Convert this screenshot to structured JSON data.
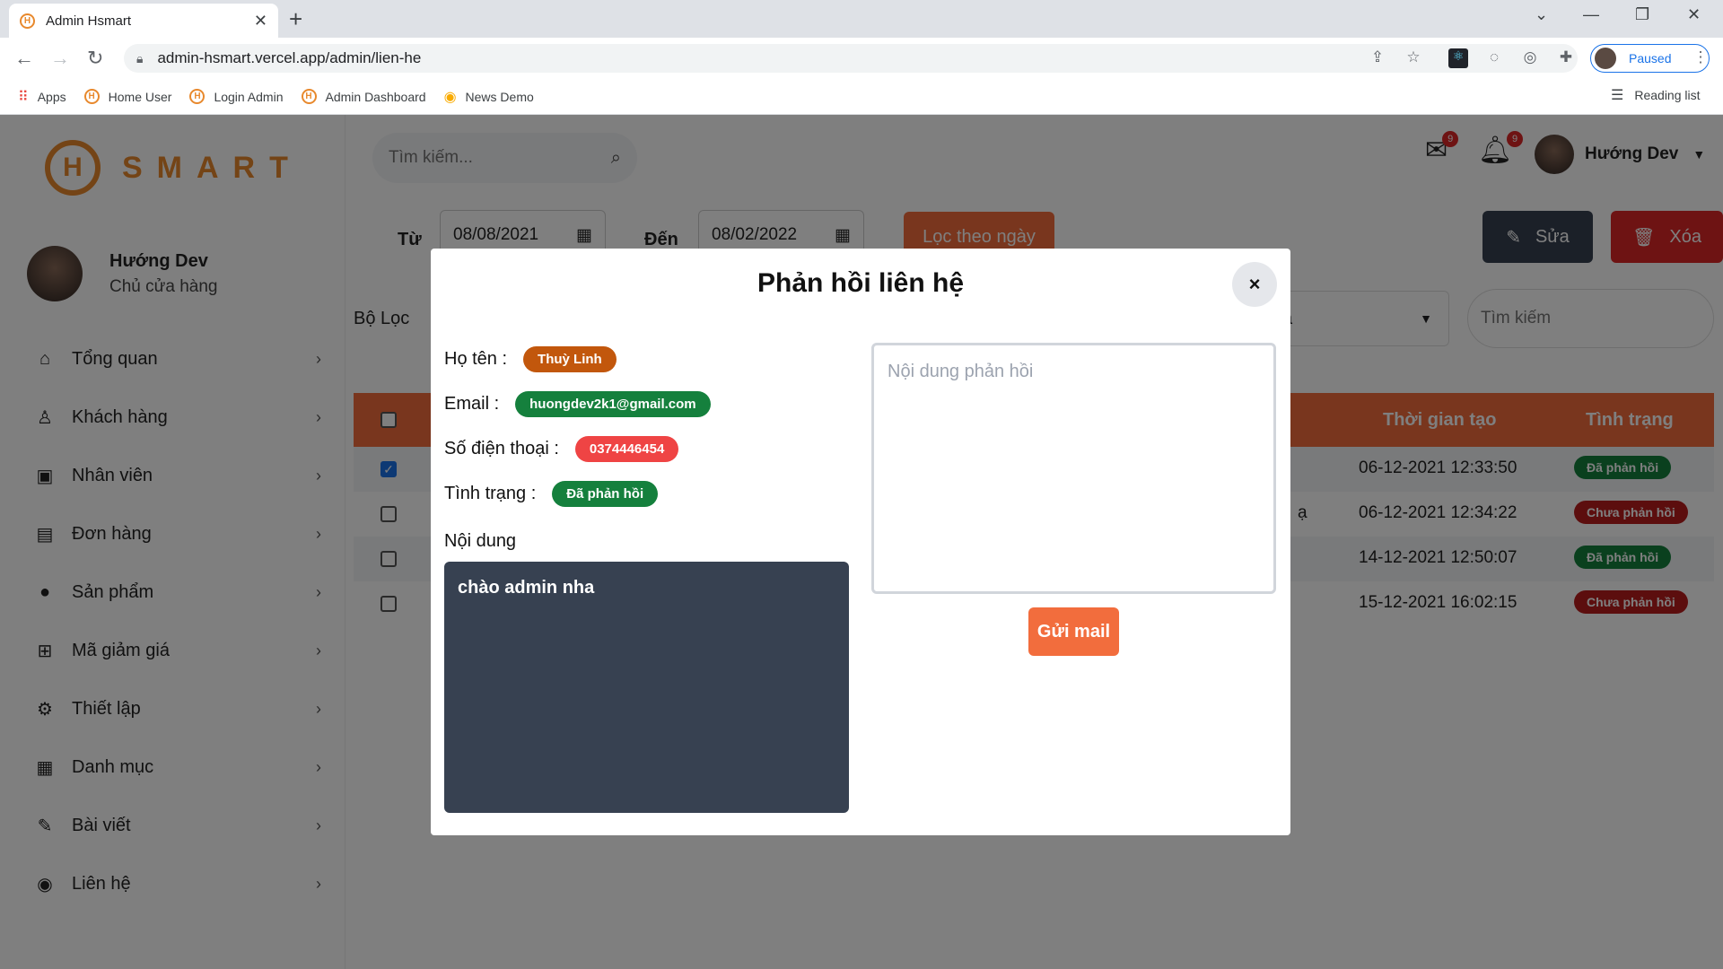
{
  "browser": {
    "tab_title": "Admin Hsmart",
    "url": "admin-hsmart.vercel.app/admin/lien-he",
    "profile_label": "Paused",
    "bookmarks": [
      "Apps",
      "Home User",
      "Login Admin",
      "Admin Dashboard",
      "News Demo"
    ],
    "reading_list": "Reading list"
  },
  "logo": {
    "letter": "H",
    "word": "SMART"
  },
  "sidebar": {
    "user_name": "Hướng Dev",
    "user_role": "Chủ cửa hàng",
    "items": [
      {
        "label": "Tổng quan",
        "icon": "home-icon"
      },
      {
        "label": "Khách hàng",
        "icon": "user-icon"
      },
      {
        "label": "Nhân viên",
        "icon": "id-card-icon"
      },
      {
        "label": "Đơn hàng",
        "icon": "order-icon"
      },
      {
        "label": "Sản phẩm",
        "icon": "product-icon"
      },
      {
        "label": "Mã giảm giá",
        "icon": "gift-icon"
      },
      {
        "label": "Thiết lập",
        "icon": "gear-icon"
      },
      {
        "label": "Danh mục",
        "icon": "category-icon"
      },
      {
        "label": "Bài viết",
        "icon": "pen-icon"
      },
      {
        "label": "Liên hệ",
        "icon": "contact-icon"
      }
    ]
  },
  "topbar": {
    "search_placeholder": "Tìm kiếm...",
    "mail_count": "9",
    "notify_count": "9",
    "user_name": "Hướng Dev"
  },
  "filters": {
    "from_label": "Từ",
    "from_date": "08/08/2021",
    "to_label": "Đến",
    "to_date": "08/02/2022",
    "filter_button": "Lọc theo ngày",
    "edit_button": "Sửa",
    "delete_button": "Xóa",
    "group_label": "Bộ Lọc",
    "select_value": "cả",
    "search_placeholder": "Tìm kiếm"
  },
  "table": {
    "headers": {
      "created": "Thời gian tạo",
      "status": "Tình trạng"
    },
    "rows": [
      {
        "checked": true,
        "extra": "",
        "created": "06-12-2021 12:33:50",
        "status": "Đã phản hồi",
        "status_color": "#15803d"
      },
      {
        "checked": false,
        "extra": "ạ",
        "created": "06-12-2021 12:34:22",
        "status": "Chưa phản hồi",
        "status_color": "#b91c1c"
      },
      {
        "checked": false,
        "extra": "",
        "created": "14-12-2021 12:50:07",
        "status": "Đã phản hồi",
        "status_color": "#15803d"
      },
      {
        "checked": false,
        "extra": "",
        "created": "15-12-2021 16:02:15",
        "status": "Chưa phản hồi",
        "status_color": "#b91c1c"
      }
    ]
  },
  "modal": {
    "title": "Phản hồi liên hệ",
    "close": "×",
    "name_label": "Họ tên :",
    "name": "Thuỳ Linh",
    "email_label": "Email :",
    "email": "huongdev2k1@gmail.com",
    "phone_label": "Số điện thoại :",
    "phone": "0374446454",
    "status_label": "Tình trạng :",
    "status": "Đã phản hồi",
    "content_label": "Nội dung",
    "content": "chào admin nha",
    "reply_placeholder": "Nội dung phản hồi",
    "send_button": "Gửi mail"
  },
  "colors": {
    "accent": "#f26d3d",
    "brand": "#e8892d",
    "name_pill": "#c2570c",
    "email_pill": "#15803d",
    "phone_pill": "#ef4444"
  }
}
